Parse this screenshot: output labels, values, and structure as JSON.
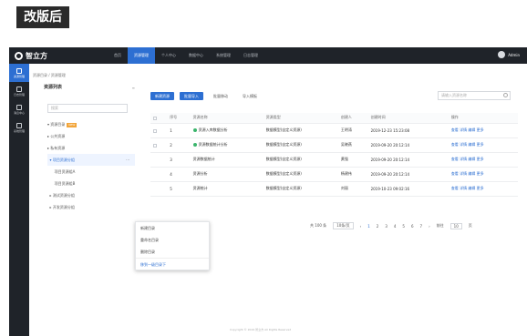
{
  "caption": "改版后",
  "app": {
    "brand": "智立方",
    "user": "Admin"
  },
  "nav": [
    {
      "label": "首页"
    },
    {
      "label": "资源管理"
    },
    {
      "label": "个人中心"
    },
    {
      "label": "数据中心"
    },
    {
      "label": "系统管理"
    },
    {
      "label": "日志管理"
    }
  ],
  "rail": [
    {
      "label": "资源管理"
    },
    {
      "label": "日志管理"
    },
    {
      "label": "消息中心"
    },
    {
      "label": "系统管理"
    }
  ],
  "breadcrumb": "资源目录 / 资源管理",
  "sidebar": {
    "title": "资源列表",
    "search_placeholder": "搜索",
    "tree": [
      {
        "label": "资源目录",
        "tag": "NEW"
      },
      {
        "label": "公共资源"
      },
      {
        "label": "私有资源"
      },
      {
        "label": "项目资源分组"
      },
      {
        "label": "项目资源组A"
      },
      {
        "label": "项目资源组B"
      },
      {
        "label": "测试资源分组"
      },
      {
        "label": "开发资源分组"
      }
    ]
  },
  "context_menu": [
    {
      "label": "新建目录"
    },
    {
      "label": "重命名目录"
    },
    {
      "label": "删除目录"
    },
    {
      "label": "移到一级目录下"
    }
  ],
  "toolbar": {
    "new_label": "新建资源",
    "import_label": "批量导入",
    "move_label": "批量移动",
    "delete_label": "导入模板",
    "search_placeholder": "请输入资源名称"
  },
  "table": {
    "headers": [
      "序号",
      "资源名称",
      "资源类型",
      "创建人",
      "创建时间",
      "操作"
    ],
    "rows": [
      {
        "no": "1",
        "name": "资源入库数据分析",
        "type": "数据模型(自定义资源)",
        "owner": "王明涛",
        "time": "2019-12-23 15:23:08",
        "ops": "查看  详情  编辑  更多"
      },
      {
        "no": "2",
        "name": "资源数据统计分析",
        "type": "数据模型(自定义资源)",
        "owner": "吴晓燕",
        "time": "2019-09-20 20:12:14",
        "ops": "查看  详情  编辑  更多"
      },
      {
        "no": "3",
        "name": "资源数据统计",
        "type": "数据模型(自定义资源)",
        "owner": "黄强",
        "time": "2019-09-20 20:12:14",
        "ops": "查看  详情  编辑  更多"
      },
      {
        "no": "4",
        "name": "资源分析",
        "type": "数据模型(自定义资源)",
        "owner": "杨建伟",
        "time": "2019-09-20 20:12:14",
        "ops": "查看  详情  编辑  更多"
      },
      {
        "no": "5",
        "name": "资源统计",
        "type": "数据模型(自定义资源)",
        "owner": "刘丽",
        "time": "2019-10-23 09:02:16",
        "ops": "查看  详情  编辑  更多"
      }
    ]
  },
  "pager": {
    "total": "共 100 条",
    "size": "10条/页",
    "pages": [
      "1",
      "2",
      "3",
      "4",
      "5",
      "6",
      "7"
    ],
    "jump": "前往",
    "page_input": "10",
    "page_unit": "页"
  },
  "footer": "Copyright © 2019 智立方 All Rights Reserved"
}
